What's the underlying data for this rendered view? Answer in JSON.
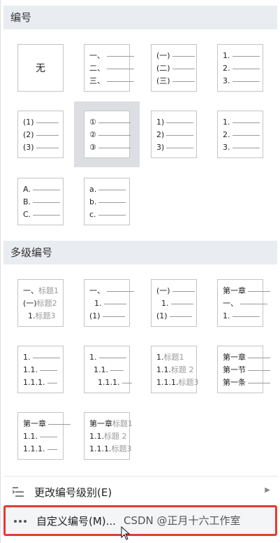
{
  "sections": {
    "numbering": "编号",
    "multilevel": "多级编号"
  },
  "numbering": [
    {
      "kind": "none",
      "label": "无"
    },
    {
      "lines": [
        {
          "t": "一、"
        },
        {
          "t": "二、"
        },
        {
          "t": "三、"
        }
      ]
    },
    {
      "lines": [
        {
          "t": "(一)"
        },
        {
          "t": "(二)"
        },
        {
          "t": "(三)"
        }
      ]
    },
    {
      "lines": [
        {
          "t": "1."
        },
        {
          "t": "2."
        },
        {
          "t": "3."
        }
      ]
    },
    {
      "lines": [
        {
          "t": "(1)"
        },
        {
          "t": "(2)"
        },
        {
          "t": "(3)"
        }
      ]
    },
    {
      "lines": [
        {
          "t": "①"
        },
        {
          "t": "②"
        },
        {
          "t": "③"
        }
      ],
      "selected": true
    },
    {
      "lines": [
        {
          "t": "1)"
        },
        {
          "t": "2)"
        },
        {
          "t": "3)"
        }
      ]
    },
    {
      "lines": [
        {
          "t": "1."
        },
        {
          "t": "2."
        },
        {
          "t": "3."
        }
      ]
    },
    {
      "lines": [
        {
          "t": "A."
        },
        {
          "t": "B."
        },
        {
          "t": "C."
        }
      ]
    },
    {
      "lines": [
        {
          "t": "a."
        },
        {
          "t": "b."
        },
        {
          "t": "c."
        }
      ]
    }
  ],
  "multilevel": [
    {
      "lines": [
        {
          "t": "一、",
          "g": "标题1"
        },
        {
          "t": "(一)",
          "g": "标题2"
        },
        {
          "t": "1.",
          "g": "标题3"
        }
      ]
    },
    {
      "lines": [
        {
          "t": "一、"
        },
        {
          "t": "1."
        },
        {
          "t": "(1)"
        }
      ]
    },
    {
      "lines": [
        {
          "t": "(一)"
        },
        {
          "t": "1."
        },
        {
          "t": "(1)"
        }
      ]
    },
    {
      "lines": [
        {
          "t": "第一章"
        },
        {
          "t": "一、"
        },
        {
          "t": "1."
        }
      ]
    },
    {
      "lines": [
        {
          "t": "1."
        },
        {
          "t": "1.1."
        },
        {
          "t": "1.1.1."
        }
      ]
    },
    {
      "lines": [
        {
          "t": "1."
        },
        {
          "t": "1.1."
        },
        {
          "t": "1.1.1."
        }
      ]
    },
    {
      "lines": [
        {
          "t": "1.",
          "g": "标题1"
        },
        {
          "t": "1.1.",
          "g": "标题 2"
        },
        {
          "t": "1.1.1.",
          "g": "标题3"
        }
      ]
    },
    {
      "lines": [
        {
          "t": "第一章"
        },
        {
          "t": "第一节"
        },
        {
          "t": "第一条"
        }
      ]
    },
    {
      "lines": [
        {
          "t": "第一章"
        },
        {
          "t": "1.1."
        },
        {
          "t": "1.1.1."
        }
      ]
    },
    {
      "lines": [
        {
          "t": "第一章",
          "g": "标题1"
        },
        {
          "t": "1.1.",
          "g": "标题 2"
        },
        {
          "t": "1.1.1.",
          "g": "标题3"
        }
      ]
    }
  ],
  "menu": {
    "change_level": "更改编号级别(E)",
    "custom": "自定义编号(M)..."
  },
  "watermark": "CSDN @正月十六工作室",
  "colors": {
    "header_bg": "#e9ecf1",
    "selected_bg": "#dcdee2",
    "highlight_border": "#e53b31"
  }
}
